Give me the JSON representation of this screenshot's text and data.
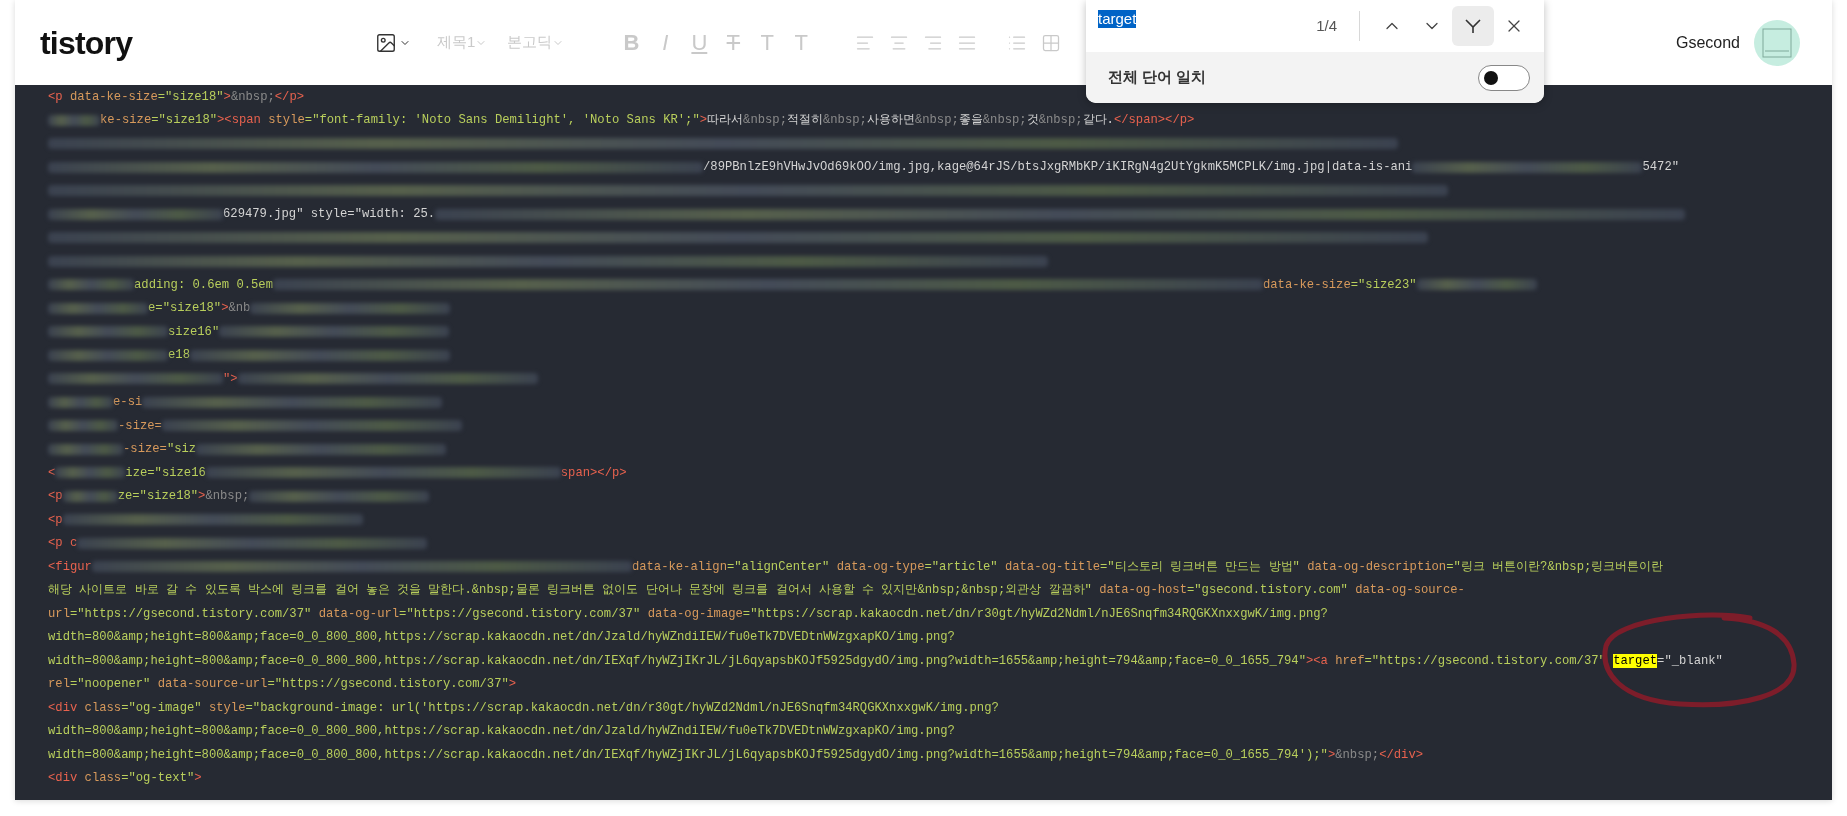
{
  "header": {
    "logo": "tistory",
    "toolbar": [
      {
        "kind": "image",
        "disabled": false
      },
      {
        "kind": "dropdown",
        "label": "제목1",
        "disabled": true
      },
      {
        "kind": "dropdown",
        "label": "본고딕",
        "disabled": true
      },
      {
        "kind": "bold",
        "label": "B",
        "disabled": true
      },
      {
        "kind": "italic",
        "label": "I",
        "disabled": true
      },
      {
        "kind": "underline",
        "label": "U",
        "disabled": true
      },
      {
        "kind": "strike",
        "label": "T",
        "disabled": true
      },
      {
        "kind": "plain",
        "label": "T",
        "disabled": true
      },
      {
        "kind": "plain",
        "label": "T",
        "disabled": true
      },
      {
        "kind": "align-left",
        "disabled": true
      },
      {
        "kind": "align-center",
        "disabled": true
      },
      {
        "kind": "align-right",
        "disabled": true
      },
      {
        "kind": "align-justify",
        "disabled": true
      },
      {
        "kind": "list",
        "disabled": true
      },
      {
        "kind": "table",
        "disabled": true
      }
    ],
    "user": {
      "name": "Gsecond"
    }
  },
  "find_bar": {
    "query": "target",
    "count": "1/4",
    "filter_button": {
      "selected": true
    },
    "whole_word": {
      "label": "전체 단어 일치",
      "on": false
    }
  },
  "code_lines": [
    {
      "segments": [
        {
          "kind": "tag",
          "text": "<p "
        },
        {
          "kind": "attr",
          "text": "data-ke-size"
        },
        {
          "kind": "value",
          "text": "=\"size18\""
        },
        {
          "kind": "tag",
          "text": ">"
        },
        {
          "kind": "entity",
          "text": "&nbsp;"
        },
        {
          "kind": "tag",
          "text": "</p>"
        }
      ]
    },
    {
      "segments": [
        {
          "kind": "blur"
        },
        {
          "kind": "attr",
          "text": "ke-size"
        },
        {
          "kind": "value",
          "text": "=\"size18\""
        },
        {
          "kind": "tag",
          "text": "><span "
        },
        {
          "kind": "attr",
          "text": "style"
        },
        {
          "kind": "value",
          "text": "=\"font-family: 'Noto Sans Demilight', 'Noto Sans KR';\""
        },
        {
          "kind": "tag",
          "text": ">"
        },
        {
          "kind": "text",
          "text": "따라서"
        },
        {
          "kind": "entity",
          "text": "&nbsp;"
        },
        {
          "kind": "text",
          "text": "적절히"
        },
        {
          "kind": "entity",
          "text": "&nbsp;"
        },
        {
          "kind": "text",
          "text": "사용하면"
        },
        {
          "kind": "entity",
          "text": "&nbsp;"
        },
        {
          "kind": "text",
          "text": "좋을"
        },
        {
          "kind": "entity",
          "text": "&nbsp;"
        },
        {
          "kind": "text",
          "text": "것"
        },
        {
          "kind": "entity",
          "text": "&nbsp;"
        },
        {
          "kind": "text",
          "text": "같다."
        },
        {
          "kind": "tag",
          "text": "</span></p>"
        }
      ]
    },
    {
      "segments": [
        {
          "kind": "blur"
        }
      ]
    },
    {
      "segments": [
        {
          "kind": "blur"
        },
        {
          "kind": "text",
          "text": "/89PBnlzE9hVHwJvOd69kOO/img.jpg,kage@64rJS/btsJxgRMbKP/iKIRgN4g2UtYgkmK5MCPLK/img.jpg|data-is-ani"
        },
        {
          "kind": "blur"
        },
        {
          "kind": "text",
          "text": "5472\""
        }
      ]
    },
    {
      "segments": [
        {
          "kind": "blur"
        }
      ]
    },
    {
      "segments": [
        {
          "kind": "blur"
        },
        {
          "kind": "text",
          "text": "629479.jpg\" style=\"width: 25."
        },
        {
          "kind": "blur"
        }
      ]
    },
    {
      "segments": [
        {
          "kind": "blur"
        }
      ]
    },
    {
      "segments": [
        {
          "kind": "blur"
        }
      ]
    },
    {
      "segments": [
        {
          "kind": "blur"
        },
        {
          "kind": "value",
          "text": "adding: 0.6em 0.5em"
        },
        {
          "kind": "blur"
        },
        {
          "kind": "attr",
          "text": "data-ke-size"
        },
        {
          "kind": "value",
          "text": "=\"size23\""
        },
        {
          "kind": "blur"
        }
      ]
    },
    {
      "segments": [
        {
          "kind": "blur"
        },
        {
          "kind": "value",
          "text": "e=\"size18\""
        },
        {
          "kind": "tag",
          "text": ">"
        },
        {
          "kind": "entity",
          "text": "&nb"
        },
        {
          "kind": "blur"
        }
      ]
    },
    {
      "segments": [
        {
          "kind": "blur"
        },
        {
          "kind": "value",
          "text": "size16\""
        },
        {
          "kind": "blur"
        }
      ]
    },
    {
      "segments": [
        {
          "kind": "blur"
        },
        {
          "kind": "value",
          "text": "e18"
        },
        {
          "kind": "blur"
        }
      ]
    },
    {
      "segments": [
        {
          "kind": "blur"
        },
        {
          "kind": "tag",
          "text": "\">"
        },
        {
          "kind": "blur"
        }
      ]
    },
    {
      "segments": [
        {
          "kind": "blur"
        },
        {
          "kind": "attr",
          "text": "e-si"
        },
        {
          "kind": "blur"
        }
      ]
    },
    {
      "segments": [
        {
          "kind": "blur"
        },
        {
          "kind": "attr",
          "text": "-size="
        },
        {
          "kind": "blur"
        }
      ]
    },
    {
      "segments": [
        {
          "kind": "blur"
        },
        {
          "kind": "attr",
          "text": "-size="
        },
        {
          "kind": "value",
          "text": "\"siz"
        },
        {
          "kind": "blur"
        }
      ]
    },
    {
      "segments": [
        {
          "kind": "tag",
          "text": "<"
        },
        {
          "kind": "blur"
        },
        {
          "kind": "value",
          "text": "ize=\"size16"
        },
        {
          "kind": "blur"
        },
        {
          "kind": "tag",
          "text": "span></p>"
        }
      ]
    },
    {
      "segments": [
        {
          "kind": "tag",
          "text": "<p"
        },
        {
          "kind": "blur"
        },
        {
          "kind": "value",
          "text": "ze=\"size18\""
        },
        {
          "kind": "tag",
          "text": ">"
        },
        {
          "kind": "entity",
          "text": "&nbsp;"
        },
        {
          "kind": "blur"
        }
      ]
    },
    {
      "segments": [
        {
          "kind": "tag",
          "text": "<p"
        },
        {
          "kind": "blur"
        }
      ]
    },
    {
      "segments": [
        {
          "kind": "tag",
          "text": "<p c"
        },
        {
          "kind": "blur"
        }
      ]
    },
    {
      "segments": [
        {
          "kind": "tag",
          "text": "<figur"
        },
        {
          "kind": "blur"
        },
        {
          "kind": "attr",
          "text": "data-ke-align"
        },
        {
          "kind": "value",
          "text": "=\"alignCenter\" "
        },
        {
          "kind": "attr",
          "text": "data-og-type"
        },
        {
          "kind": "value",
          "text": "=\"article\" "
        },
        {
          "kind": "attr",
          "text": "data-og-title"
        },
        {
          "kind": "value",
          "text": "=\"티스토리 링크버튼 만드는 방법\" "
        },
        {
          "kind": "attr",
          "text": "data-og-description"
        },
        {
          "kind": "value",
          "text": "=\"링크 버튼이란?&nbsp;링크버튼이란"
        }
      ]
    },
    {
      "segments": [
        {
          "kind": "value",
          "text": "해당 사이트로 바로 갈 수 있도록 박스에 링크를 걸어 놓은 것을 말한다.&nbsp;물론 링크버튼 없이도 단어나 문장에 링크를 걸어서 사용할 수 있지만&nbsp;&nbsp;외관상 깔끔하\" "
        },
        {
          "kind": "attr",
          "text": "data-og-host"
        },
        {
          "kind": "value",
          "text": "=\"gsecond.tistory.com\" "
        },
        {
          "kind": "attr",
          "text": "data-og-source-"
        }
      ]
    },
    {
      "segments": [
        {
          "kind": "attr",
          "text": "url"
        },
        {
          "kind": "value",
          "text": "=\"https://gsecond.tistory.com/37\" "
        },
        {
          "kind": "attr",
          "text": "data-og-url"
        },
        {
          "kind": "value",
          "text": "=\"https://gsecond.tistory.com/37\" "
        },
        {
          "kind": "attr",
          "text": "data-og-image"
        },
        {
          "kind": "value",
          "text": "=\"https://scrap.kakaocdn.net/dn/r30gt/hyWZd2Ndml/nJE6Snqfm34RQGKXnxxgwK/img.png?"
        }
      ]
    },
    {
      "segments": [
        {
          "kind": "value",
          "text": "width=800&amp;height=800&amp;face=0_0_800_800,https://scrap.kakaocdn.net/dn/Jzald/hyWZndiIEW/fu0eTk7DVEDtnWWzgxapKO/img.png?"
        }
      ]
    },
    {
      "segments": [
        {
          "kind": "value",
          "text": "width=800&amp;height=800&amp;face=0_0_800_800,https://scrap.kakaocdn.net/dn/IEXqf/hyWZjIKrJL/jL6qyapsbKOJf5925dgydO/img.png?width=1655&amp;height=794&amp;face=0_0_1655_794\""
        },
        {
          "kind": "tag",
          "text": "><a "
        },
        {
          "kind": "attr",
          "text": "href"
        },
        {
          "kind": "value",
          "text": "=\"https://gsecond.tistory.com/37\" "
        },
        {
          "kind": "match",
          "text": "target"
        },
        {
          "kind": "text",
          "text": "=\"_blank\""
        }
      ]
    },
    {
      "segments": [
        {
          "kind": "attr",
          "text": "rel"
        },
        {
          "kind": "value",
          "text": "=\"noopener\" "
        },
        {
          "kind": "attr",
          "text": "data-source-url"
        },
        {
          "kind": "value",
          "text": "=\"https://gsecond.tistory.com/37\""
        },
        {
          "kind": "tag",
          "text": ">"
        }
      ]
    },
    {
      "segments": [
        {
          "kind": "tag",
          "text": "<div "
        },
        {
          "kind": "attr",
          "text": "class"
        },
        {
          "kind": "value",
          "text": "=\"og-image\" "
        },
        {
          "kind": "attr",
          "text": "style"
        },
        {
          "kind": "value",
          "text": "=\"background-image: url('https://scrap.kakaocdn.net/dn/r30gt/hyWZd2Ndml/nJE6Snqfm34RQGKXnxxgwK/img.png?"
        }
      ]
    },
    {
      "segments": [
        {
          "kind": "value",
          "text": "width=800&amp;height=800&amp;face=0_0_800_800,https://scrap.kakaocdn.net/dn/Jzald/hyWZndiIEW/fu0eTk7DVEDtnWWzgxapKO/img.png?"
        }
      ]
    },
    {
      "segments": [
        {
          "kind": "value",
          "text": "width=800&amp;height=800&amp;face=0_0_800_800,https://scrap.kakaocdn.net/dn/IEXqf/hyWZjIKrJL/jL6qyapsbKOJf5925dgydO/img.png?width=1655&amp;height=794&amp;face=0_0_1655_794');\""
        },
        {
          "kind": "tag",
          "text": ">"
        },
        {
          "kind": "entity",
          "text": "&nbsp;"
        },
        {
          "kind": "tag",
          "text": "</div>"
        }
      ]
    },
    {
      "segments": [
        {
          "kind": "tag",
          "text": "<div "
        },
        {
          "kind": "attr",
          "text": "class"
        },
        {
          "kind": "value",
          "text": "=\"og-text\""
        },
        {
          "kind": "tag",
          "text": ">"
        }
      ]
    }
  ]
}
